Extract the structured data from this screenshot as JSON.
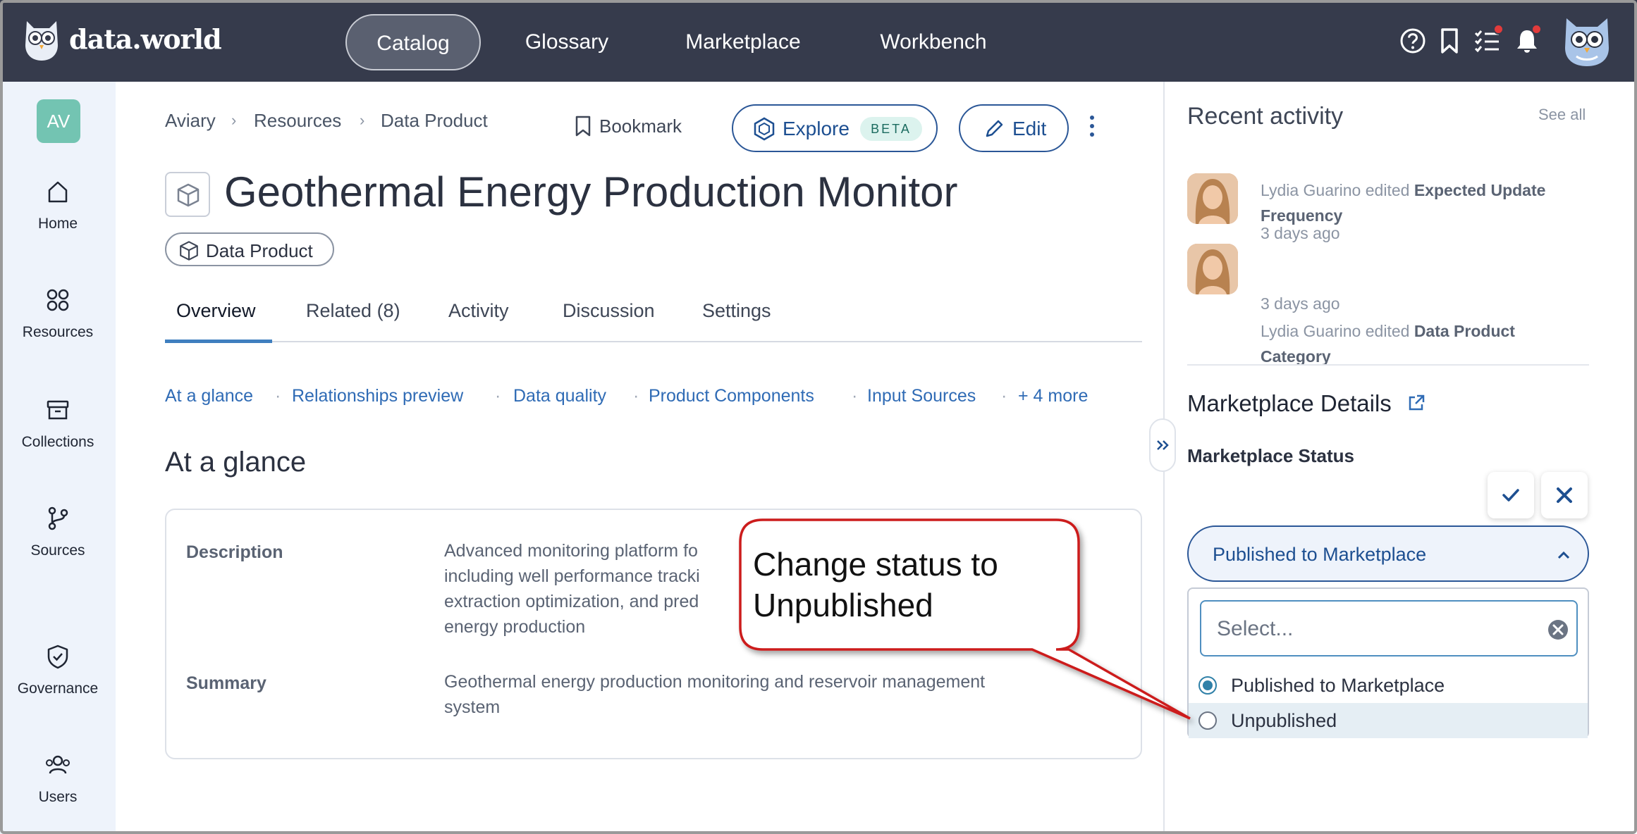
{
  "app": {
    "logo_text": "data.world"
  },
  "topnav": {
    "items": [
      "Catalog",
      "Glossary",
      "Marketplace",
      "Workbench"
    ],
    "active": "Catalog"
  },
  "top_icons": [
    "help-icon",
    "bookmark-icon",
    "tasks-icon",
    "bell-icon",
    "user-avatar"
  ],
  "sidebar": {
    "org_badge": "AV",
    "items": [
      {
        "label": "Home",
        "icon": "home-icon"
      },
      {
        "label": "Resources",
        "icon": "resources-icon"
      },
      {
        "label": "Collections",
        "icon": "collections-icon"
      },
      {
        "label": "Sources",
        "icon": "sources-icon"
      },
      {
        "label": "Governance",
        "icon": "governance-icon"
      },
      {
        "label": "Users",
        "icon": "users-icon"
      }
    ]
  },
  "breadcrumb": [
    "Aviary",
    "Resources",
    "Data Product"
  ],
  "toolbar": {
    "bookmark_label": "Bookmark",
    "explore_label": "Explore",
    "beta_label": "BETA",
    "edit_label": "Edit"
  },
  "resource": {
    "title": "Geothermal Energy Production Monitor",
    "type_label": "Data Product"
  },
  "tabs": [
    "Overview",
    "Related (8)",
    "Activity",
    "Discussion",
    "Settings"
  ],
  "active_tab": "Overview",
  "jump_links": [
    "At a glance",
    "Relationships preview",
    "Data quality",
    "Product Components",
    "Input Sources",
    "+ 4 more"
  ],
  "glance": {
    "title": "At a glance",
    "description_label": "Description",
    "description_lines": [
      "Advanced monitoring platform fo",
      "including well performance tracki",
      "extraction optimization, and pred",
      "energy production"
    ],
    "summary_label": "Summary",
    "summary_lines": [
      "Geothermal energy production monitoring and reservoir management",
      "system"
    ]
  },
  "recent_activity": {
    "title": "Recent activity",
    "see_all": "See all",
    "items": [
      {
        "user": "Lydia Guarino",
        "verb": "edited",
        "field_line1": "Expected Update",
        "field_line2": "Frequency",
        "time": "3 days ago"
      },
      {
        "user": "Lydia Guarino",
        "verb": "edited",
        "field_line1": "Data Product",
        "field_line2": "Category",
        "time": "3 days ago"
      }
    ]
  },
  "marketplace": {
    "title": "Marketplace Details",
    "status_label": "Marketplace Status",
    "selected_value": "Published to Marketplace",
    "search_placeholder": "Select...",
    "options": [
      "Published to Marketplace",
      "Unpublished"
    ],
    "checked_option": "Published to Marketplace"
  },
  "callout": {
    "line1": "Change status to",
    "line2": "Unpublished"
  },
  "colors": {
    "topbar": "#363b4c",
    "sidebar": "#eef3fb",
    "accent": "#2b5797",
    "callout_border": "#cc1f1f"
  }
}
